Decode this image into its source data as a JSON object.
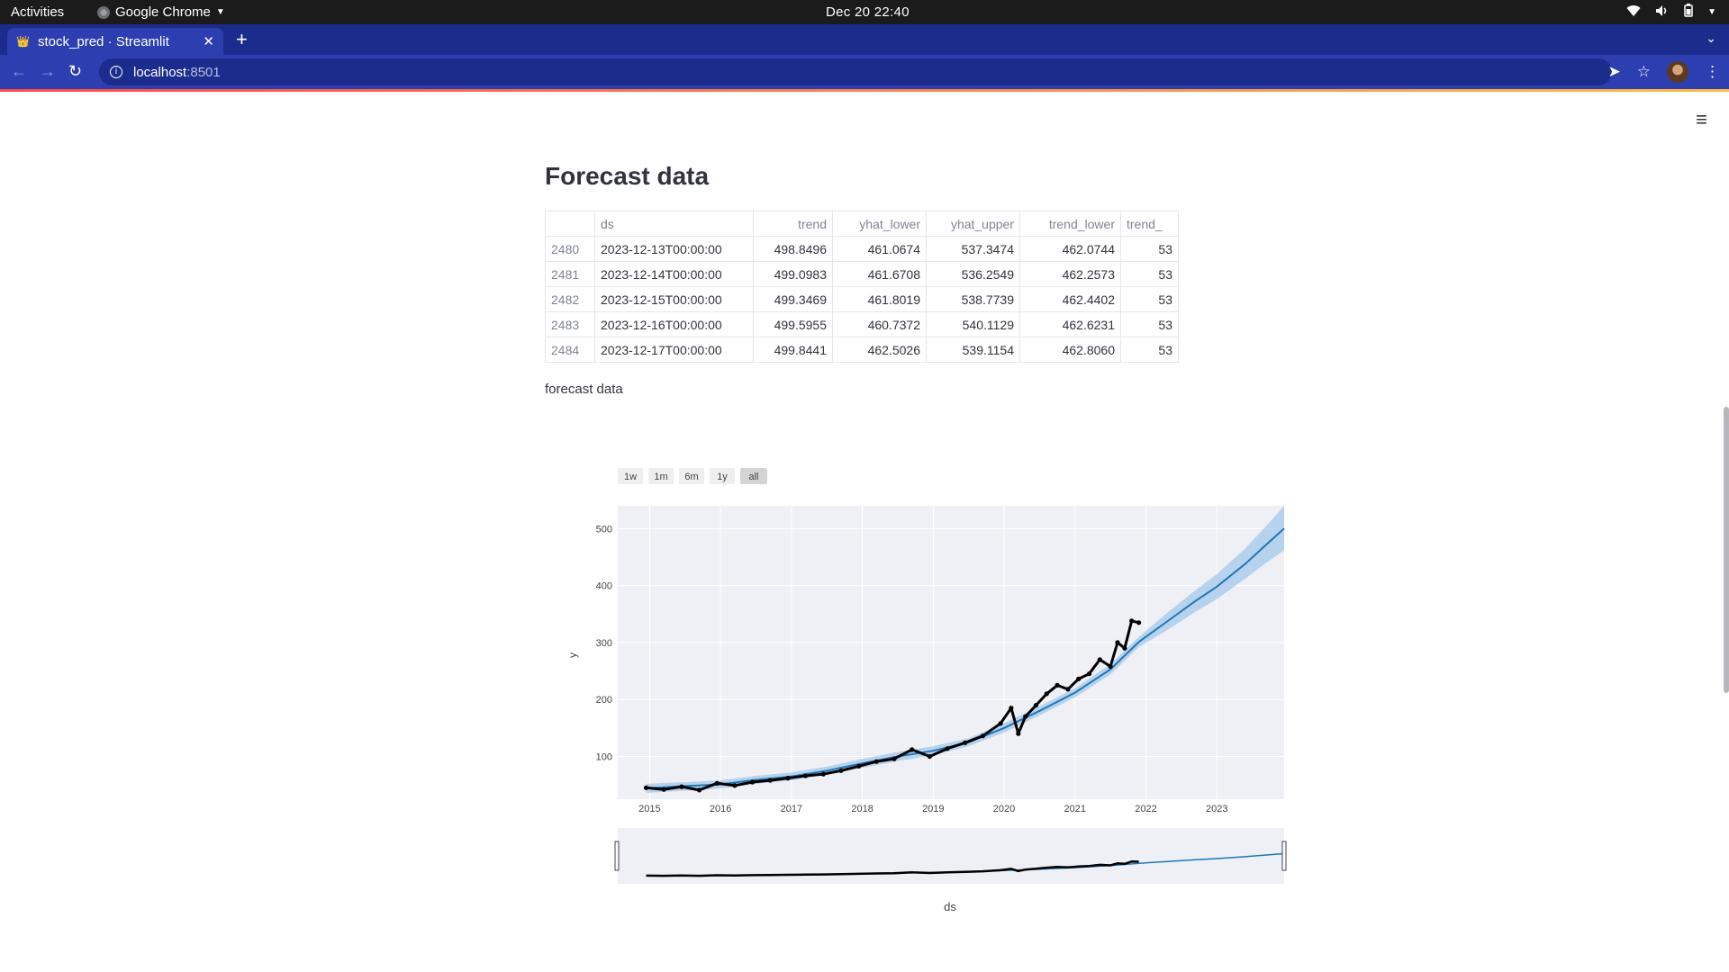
{
  "os": {
    "activities": "Activities",
    "app_name": "Google Chrome",
    "clock": "Dec 20  22:40"
  },
  "browser": {
    "tab_title": "stock_pred · Streamlit",
    "url_host": "localhost",
    "url_port": ":8501"
  },
  "page": {
    "heading": "Forecast data",
    "caption": "forecast data",
    "table": {
      "columns": [
        "",
        "ds",
        "trend",
        "yhat_lower",
        "yhat_upper",
        "trend_lower",
        "trend_"
      ],
      "rows": [
        {
          "idx": "2480",
          "ds": "2023-12-13T00:00:00",
          "trend": "498.8496",
          "yhat_lower": "461.0674",
          "yhat_upper": "537.3474",
          "trend_lower": "462.0744",
          "trend_upper": "53"
        },
        {
          "idx": "2481",
          "ds": "2023-12-14T00:00:00",
          "trend": "499.0983",
          "yhat_lower": "461.6708",
          "yhat_upper": "536.2549",
          "trend_lower": "462.2573",
          "trend_upper": "53"
        },
        {
          "idx": "2482",
          "ds": "2023-12-15T00:00:00",
          "trend": "499.3469",
          "yhat_lower": "461.8019",
          "yhat_upper": "538.7739",
          "trend_lower": "462.4402",
          "trend_upper": "53"
        },
        {
          "idx": "2483",
          "ds": "2023-12-16T00:00:00",
          "trend": "499.5955",
          "yhat_lower": "460.7372",
          "yhat_upper": "540.1129",
          "trend_lower": "462.6231",
          "trend_upper": "53"
        },
        {
          "idx": "2484",
          "ds": "2023-12-17T00:00:00",
          "trend": "499.8441",
          "yhat_lower": "462.5026",
          "yhat_upper": "539.1154",
          "trend_lower": "462.8060",
          "trend_upper": "53"
        }
      ]
    }
  },
  "range_buttons": [
    "1w",
    "1m",
    "6m",
    "1y",
    "all"
  ],
  "range_selected": "all",
  "colors": {
    "forecast_line": "#1f77b4",
    "uncertainty_band": "#9ec5ea",
    "actual_points": "#000000",
    "plot_bg": "#eef0f6",
    "accent": "#ff4b4b"
  },
  "chart_data": {
    "type": "line",
    "xlabel": "ds",
    "ylabel": "y",
    "x_ticks": [
      "2015",
      "2016",
      "2017",
      "2018",
      "2019",
      "2020",
      "2021",
      "2022",
      "2023"
    ],
    "y_ticks": [
      100,
      200,
      300,
      400,
      500
    ],
    "xlim": [
      2014.55,
      2023.95
    ],
    "ylim": [
      25,
      540
    ],
    "grid": true,
    "range_slider": true,
    "series": [
      {
        "style": "band",
        "x": [
          2014.95,
          2015.5,
          2016.0,
          2016.5,
          2017.0,
          2017.5,
          2018.0,
          2018.5,
          2019.0,
          2019.5,
          2020.0,
          2020.5,
          2021.0,
          2021.5,
          2021.9,
          2022.3,
          2022.7,
          2023.0,
          2023.4,
          2023.7,
          2023.95
        ],
        "upper": [
          52,
          55,
          58,
          66,
          72,
          82,
          96,
          108,
          118,
          132,
          158,
          188,
          220,
          262,
          310,
          352,
          392,
          420,
          465,
          505,
          540
        ],
        "lower": [
          36,
          40,
          44,
          52,
          58,
          68,
          80,
          92,
          102,
          118,
          142,
          172,
          204,
          244,
          292,
          322,
          354,
          376,
          412,
          440,
          462
        ]
      },
      {
        "style": "line",
        "x": [
          2014.95,
          2015.5,
          2016.0,
          2016.5,
          2017.0,
          2017.5,
          2018.0,
          2018.5,
          2019.0,
          2019.5,
          2020.0,
          2020.5,
          2021.0,
          2021.5,
          2021.9,
          2022.3,
          2022.7,
          2023.0,
          2023.4,
          2023.7,
          2023.95
        ],
        "y": [
          44,
          48,
          51,
          59,
          65,
          75,
          88,
          100,
          110,
          125,
          150,
          180,
          212,
          253,
          301,
          337,
          373,
          398,
          438,
          472,
          500
        ]
      },
      {
        "style": "markers",
        "x": [
          2014.95,
          2015.2,
          2015.45,
          2015.7,
          2015.95,
          2016.2,
          2016.45,
          2016.7,
          2016.95,
          2017.2,
          2017.45,
          2017.7,
          2017.95,
          2018.2,
          2018.45,
          2018.7,
          2018.95,
          2019.2,
          2019.45,
          2019.7,
          2019.95,
          2020.1,
          2020.2,
          2020.3,
          2020.45,
          2020.6,
          2020.75,
          2020.9,
          2021.05,
          2021.2,
          2021.35,
          2021.5,
          2021.6,
          2021.7,
          2021.8,
          2021.9
        ],
        "y": [
          45,
          42,
          47,
          41,
          53,
          49,
          55,
          58,
          62,
          66,
          69,
          75,
          83,
          91,
          96,
          112,
          100,
          114,
          124,
          136,
          158,
          185,
          140,
          170,
          190,
          210,
          225,
          218,
          236,
          245,
          270,
          258,
          300,
          290,
          338,
          335
        ]
      }
    ]
  }
}
